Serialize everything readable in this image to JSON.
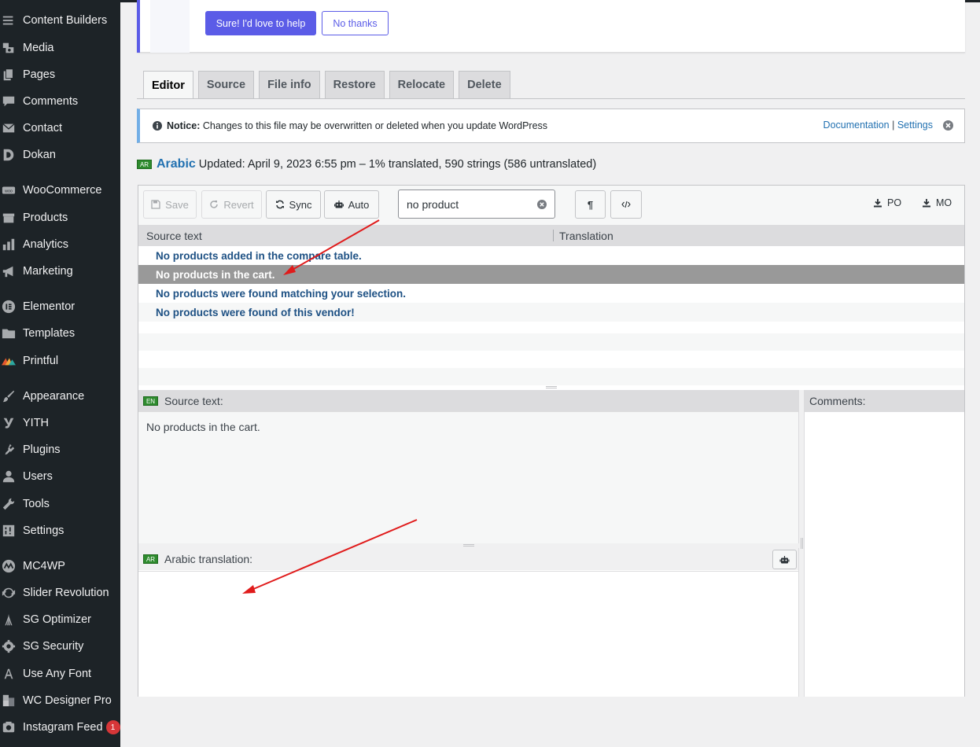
{
  "sidebar": {
    "items": [
      {
        "label": "Content Builders",
        "icon": "menu-icon"
      },
      {
        "label": "Media",
        "icon": "media-icon"
      },
      {
        "label": "Pages",
        "icon": "pages-icon"
      },
      {
        "label": "Comments",
        "icon": "comments-icon"
      },
      {
        "label": "Contact",
        "icon": "mail-icon"
      },
      {
        "label": "Dokan",
        "icon": "dokan-icon"
      },
      {
        "label": "WooCommerce",
        "icon": "woocommerce-icon"
      },
      {
        "label": "Products",
        "icon": "products-icon"
      },
      {
        "label": "Analytics",
        "icon": "analytics-icon"
      },
      {
        "label": "Marketing",
        "icon": "megaphone-icon"
      },
      {
        "label": "Elementor",
        "icon": "elementor-icon"
      },
      {
        "label": "Templates",
        "icon": "folder-icon"
      },
      {
        "label": "Printful",
        "icon": "printful-icon"
      },
      {
        "label": "Appearance",
        "icon": "paintbrush-icon"
      },
      {
        "label": "YITH",
        "icon": "yith-icon"
      },
      {
        "label": "Plugins",
        "icon": "plugin-icon"
      },
      {
        "label": "Users",
        "icon": "user-icon"
      },
      {
        "label": "Tools",
        "icon": "wrench-icon"
      },
      {
        "label": "Settings",
        "icon": "settings-icon"
      },
      {
        "label": "MC4WP",
        "icon": "mc4wp-icon"
      },
      {
        "label": "Slider Revolution",
        "icon": "refresh-icon"
      },
      {
        "label": "SG Optimizer",
        "icon": "sg-optimizer-icon"
      },
      {
        "label": "SG Security",
        "icon": "gear-icon"
      },
      {
        "label": "Use Any Font",
        "icon": "font-icon"
      },
      {
        "label": "WC Designer Pro",
        "icon": "designer-icon"
      },
      {
        "label": "Instagram Feed",
        "icon": "camera-icon",
        "badge": "1"
      }
    ]
  },
  "help_card": {
    "primary_label": "Sure! I'd love to help",
    "secondary_label": "No thanks"
  },
  "tabs": [
    "Editor",
    "Source",
    "File info",
    "Restore",
    "Relocate",
    "Delete"
  ],
  "notice": {
    "strong": "Notice:",
    "text": " Changes to this file may be overwritten or deleted when you update WordPress",
    "link_docs": "Documentation",
    "link_sep": " | ",
    "link_settings": "Settings"
  },
  "language": {
    "code": "AR",
    "name": "Arabic",
    "status": "Updated: April 9, 2023 6:55 pm – 1% translated, 590 strings (586 untranslated)"
  },
  "toolbar": {
    "save": "Save",
    "revert": "Revert",
    "sync": "Sync",
    "auto": "Auto",
    "search_value": "no product",
    "po": "PO",
    "mo": "MO"
  },
  "columns": {
    "source": "Source text",
    "translation": "Translation"
  },
  "rows": [
    "No products added in the compare table.",
    "No products in the cart.",
    "No products were found matching your selection.",
    "No products were found of this vendor!"
  ],
  "source_pane": {
    "flag": "EN",
    "title": "Source text:",
    "text": "No products in the cart."
  },
  "translation_pane": {
    "flag": "AR",
    "title": "Arabic translation:",
    "value": ""
  },
  "comments_pane": {
    "title": "Comments:"
  },
  "colors": {
    "sidebar_bg": "#1d2327",
    "accent_purple": "#5b5ce7",
    "link_blue": "#2271b1",
    "row_text": "#1e5184",
    "selected_row": "#999999",
    "annotation_arrow": "#e01b1b"
  }
}
